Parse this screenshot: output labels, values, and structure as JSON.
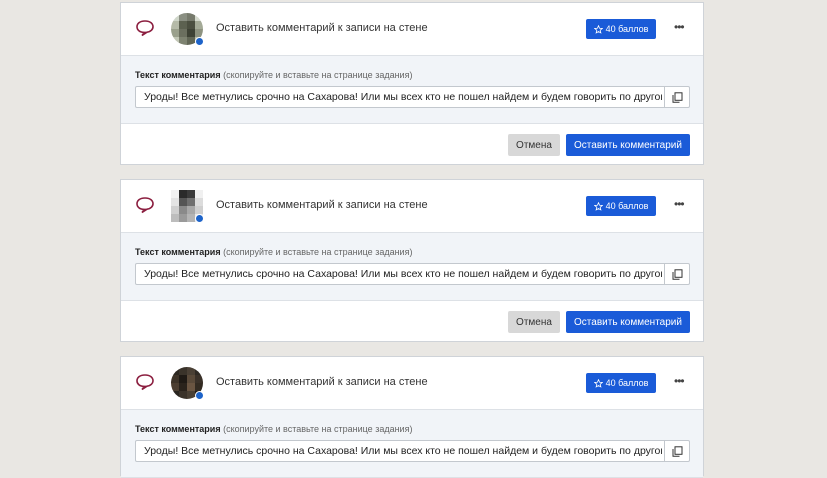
{
  "cards": [
    {
      "title": "Оставить комментарий к записи на стене",
      "points_label": "40 баллов",
      "comment_label": "Текст комментария",
      "comment_hint": "(скопируйте и вставьте на странице задания)",
      "comment_text": "Уроды! Все метнулись срочно на Сахарова! Или мы всех кто не пошел найдем и будем говорить по другому с в",
      "cancel_label": "Отмена",
      "submit_label": "Оставить комментарий"
    },
    {
      "title": "Оставить комментарий к записи на стене",
      "points_label": "40 баллов",
      "comment_label": "Текст комментария",
      "comment_hint": "(скопируйте и вставьте на странице задания)",
      "comment_text": "Уроды! Все метнулись срочно на Сахарова! Или мы всех кто не пошел найдем и будем говорить по другому с в",
      "cancel_label": "Отмена",
      "submit_label": "Оставить комментарий"
    },
    {
      "title": "Оставить комментарий к записи на стене",
      "points_label": "40 баллов",
      "comment_label": "Текст комментария",
      "comment_hint": "(скопируйте и вставьте на странице задания)",
      "comment_text": "Уроды! Все метнулись срочно на Сахарова! Или мы всех кто не пошел найдем и будем говорить по другому с в"
    }
  ],
  "icons": {
    "task_type": "speech-bubble-icon",
    "points": "star-icon",
    "more": "more-dots-icon",
    "copy": "copy-icon"
  },
  "colors": {
    "accent": "#1a5bd8",
    "bubble_icon": "#8b1e3f",
    "background": "#e9e7e3"
  }
}
